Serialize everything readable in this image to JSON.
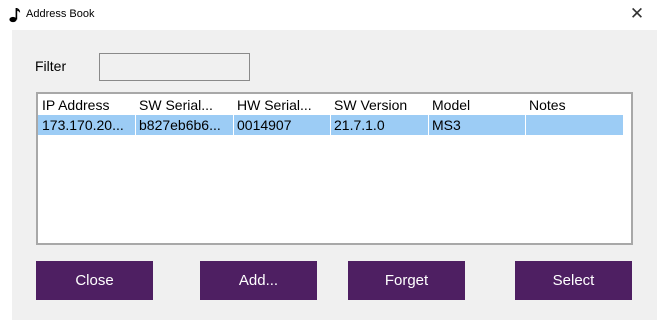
{
  "window": {
    "title": "Address Book",
    "app_icon": "music-note-icon",
    "close_glyph": "✕"
  },
  "filter": {
    "label": "Filter",
    "value": ""
  },
  "table": {
    "columns": [
      "IP Address",
      "SW Serial...",
      "HW Serial...",
      "SW Version",
      "Model",
      "Notes"
    ],
    "rows": [
      {
        "selected": true,
        "cells": [
          "173.170.20...",
          "b827eb6b6...",
          "0014907",
          "21.7.1.0",
          "MS3",
          ""
        ]
      }
    ],
    "selection_color": "#9cccf5"
  },
  "buttons": {
    "close": "Close",
    "add": "Add...",
    "forget": "Forget",
    "select": "Select"
  },
  "colors": {
    "button_bg": "#4e1f62",
    "button_text": "#ffffff",
    "client_bg": "#f0f0f0"
  }
}
